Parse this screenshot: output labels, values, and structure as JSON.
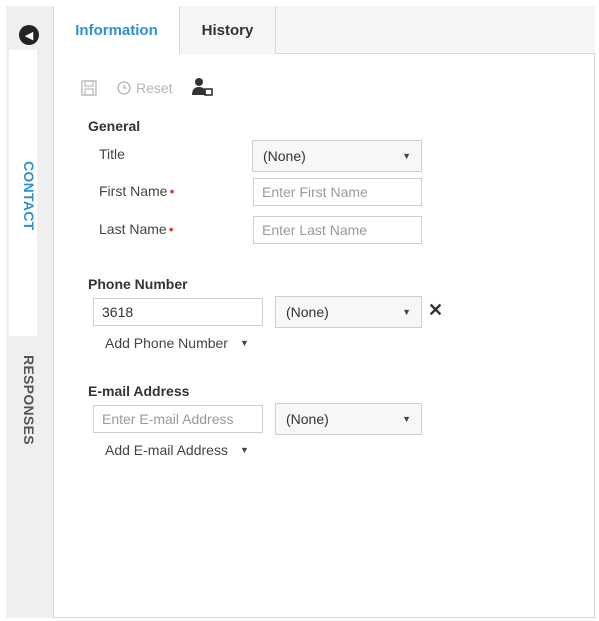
{
  "rail": {
    "tabs": [
      {
        "label": "CONTACT",
        "active": true
      },
      {
        "label": "RESPONSES",
        "active": false
      }
    ]
  },
  "tabs": [
    {
      "label": "Information",
      "active": true
    },
    {
      "label": "History",
      "active": false
    }
  ],
  "toolbar": {
    "reset_label": "Reset"
  },
  "general": {
    "title": "General",
    "title_label": "Title",
    "title_value": "(None)",
    "first_name_label": "First Name",
    "first_name_placeholder": "Enter First Name",
    "last_name_label": "Last Name",
    "last_name_placeholder": "Enter Last Name",
    "required_mark": "•"
  },
  "phone": {
    "title": "Phone Number",
    "number_value": "3618",
    "type_value": "(None)",
    "add_label": "Add Phone Number"
  },
  "email": {
    "title": "E-mail Address",
    "placeholder": "Enter E-mail Address",
    "type_value": "(None)",
    "add_label": "Add E-mail Address"
  },
  "colors": {
    "accent": "#2d8fd6",
    "required": "#e53935"
  }
}
